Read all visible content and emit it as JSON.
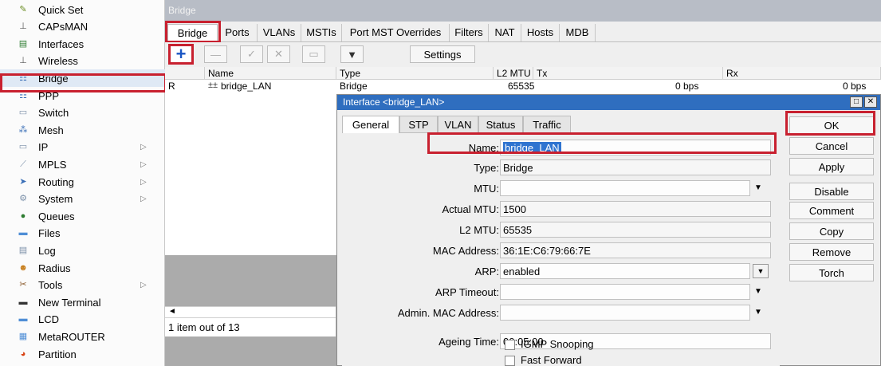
{
  "sidebar": {
    "items": [
      {
        "label": "Quick Set",
        "icon": "quick-set-icon",
        "glyph": "✎",
        "color": "#6b8e23",
        "arrow": false
      },
      {
        "label": "CAPsMAN",
        "icon": "capsman-icon",
        "glyph": "⊥",
        "color": "#555555",
        "arrow": false
      },
      {
        "label": "Interfaces",
        "icon": "interfaces-icon",
        "glyph": "▤",
        "color": "#2e7d32",
        "arrow": false
      },
      {
        "label": "Wireless",
        "icon": "wireless-icon",
        "glyph": "⊥",
        "color": "#555555",
        "arrow": false
      },
      {
        "label": "Bridge",
        "icon": "bridge-icon",
        "glyph": "⚏",
        "color": "#3a6fb7",
        "arrow": false
      },
      {
        "label": "PPP",
        "icon": "ppp-icon",
        "glyph": "⚏",
        "color": "#3a6fb7",
        "arrow": false
      },
      {
        "label": "Switch",
        "icon": "switch-icon",
        "glyph": "▭",
        "color": "#7a8fa8",
        "arrow": false
      },
      {
        "label": "Mesh",
        "icon": "mesh-icon",
        "glyph": "⁂",
        "color": "#3a6fb7",
        "arrow": false
      },
      {
        "label": "IP",
        "icon": "ip-icon",
        "glyph": "▭",
        "color": "#7a8fa8",
        "arrow": true
      },
      {
        "label": "MPLS",
        "icon": "mpls-icon",
        "glyph": "⟋",
        "color": "#7a8fa8",
        "arrow": true
      },
      {
        "label": "Routing",
        "icon": "routing-icon",
        "glyph": "➤",
        "color": "#3a6fb7",
        "arrow": true
      },
      {
        "label": "System",
        "icon": "system-icon",
        "glyph": "⚙",
        "color": "#7a8fa8",
        "arrow": true
      },
      {
        "label": "Queues",
        "icon": "queues-icon",
        "glyph": "●",
        "color": "#2e7d32",
        "arrow": false
      },
      {
        "label": "Files",
        "icon": "files-icon",
        "glyph": "▬",
        "color": "#4f8ed6",
        "arrow": false
      },
      {
        "label": "Log",
        "icon": "log-icon",
        "glyph": "▤",
        "color": "#7a8fa8",
        "arrow": false
      },
      {
        "label": "Radius",
        "icon": "radius-icon",
        "glyph": "☻",
        "color": "#c77d1a",
        "arrow": false
      },
      {
        "label": "Tools",
        "icon": "tools-icon",
        "glyph": "✂",
        "color": "#8a5a2b",
        "arrow": true
      },
      {
        "label": "New Terminal",
        "icon": "terminal-icon",
        "glyph": "▬",
        "color": "#333333",
        "arrow": false
      },
      {
        "label": "LCD",
        "icon": "lcd-icon",
        "glyph": "▬",
        "color": "#4f8ed6",
        "arrow": false
      },
      {
        "label": "MetaROUTER",
        "icon": "metarouter-icon",
        "glyph": "▦",
        "color": "#4f8ed6",
        "arrow": false
      },
      {
        "label": "Partition",
        "icon": "partition-icon",
        "glyph": "◕",
        "color": "#d84315",
        "arrow": false
      }
    ]
  },
  "bridge_window": {
    "title": "Bridge",
    "tabs": [
      "Bridge",
      "Ports",
      "VLANs",
      "MSTIs",
      "Port MST Overrides",
      "Filters",
      "NAT",
      "Hosts",
      "MDB"
    ],
    "settings_label": "Settings",
    "columns": [
      "Name",
      "Type",
      "L2 MTU",
      "Tx",
      "Rx"
    ],
    "row": {
      "flag": "R",
      "name": "bridge_LAN",
      "type": "Bridge",
      "l2mtu": "65535",
      "tx": "0 bps",
      "rx": "0 bps"
    },
    "count_text": "1 item out of 13"
  },
  "dialog": {
    "title": "Interface <bridge_LAN>",
    "tabs": [
      "General",
      "STP",
      "VLAN",
      "Status",
      "Traffic"
    ],
    "fields": {
      "name_label": "Name:",
      "name_value": "bridge_LAN",
      "type_label": "Type:",
      "type_value": "Bridge",
      "mtu_label": "MTU:",
      "mtu_value": "",
      "actual_mtu_label": "Actual MTU:",
      "actual_mtu_value": "1500",
      "l2mtu_label": "L2 MTU:",
      "l2mtu_value": "65535",
      "mac_label": "MAC Address:",
      "mac_value": "36:1E:C6:79:66:7E",
      "arp_label": "ARP:",
      "arp_value": "enabled",
      "arp_timeout_label": "ARP Timeout:",
      "arp_timeout_value": "",
      "admin_mac_label": "Admin. MAC Address:",
      "admin_mac_value": "",
      "ageing_label": "Ageing Time:",
      "ageing_value": "00:05:00",
      "igmp_label": "IGMP Snooping",
      "fast_forward_label": "Fast Forward"
    },
    "buttons": [
      "OK",
      "Cancel",
      "Apply",
      "Disable",
      "Comment",
      "Copy",
      "Remove",
      "Torch"
    ]
  }
}
